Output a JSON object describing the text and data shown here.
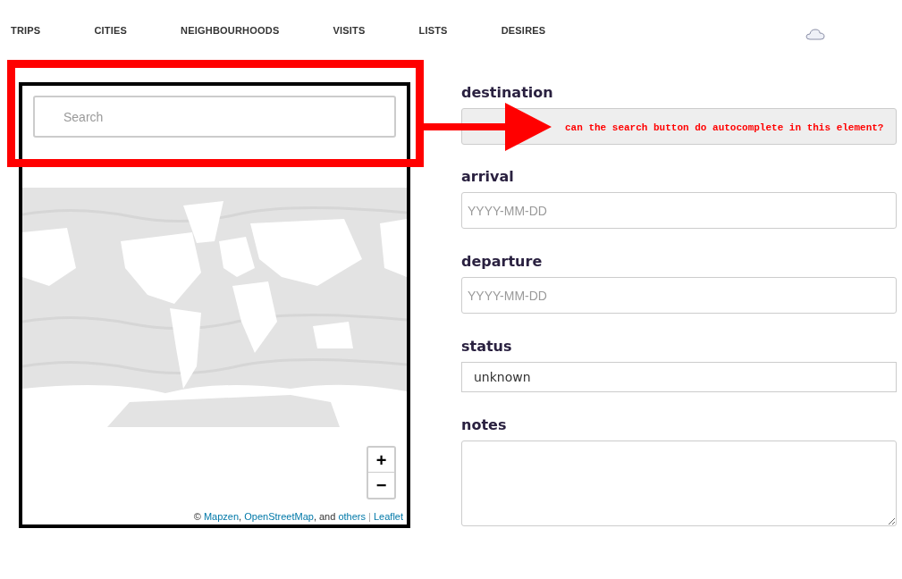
{
  "nav": {
    "items": [
      {
        "label": "TRIPS"
      },
      {
        "label": "CITIES"
      },
      {
        "label": "NEIGHBOURHOODS"
      },
      {
        "label": "VISITS"
      },
      {
        "label": "LISTS"
      },
      {
        "label": "DESIRES"
      }
    ]
  },
  "map_panel": {
    "search": {
      "placeholder": "Search"
    },
    "zoom_controls": [
      "+",
      "−"
    ],
    "attribution": [
      {
        "kind": "text",
        "text": "© "
      },
      {
        "kind": "link",
        "text": "Mapzen"
      },
      {
        "kind": "text",
        "text": ", "
      },
      {
        "kind": "link",
        "text": "OpenStreetMap"
      },
      {
        "kind": "text",
        "text": ", and "
      },
      {
        "kind": "link",
        "text": "others"
      },
      {
        "kind": "separator",
        "text": " | "
      },
      {
        "kind": "link",
        "text": "Leaflet"
      }
    ]
  },
  "form": {
    "fields": [
      {
        "label": "destination",
        "kind": "input",
        "disabled": true
      },
      {
        "label": "arrival",
        "kind": "input",
        "disabled": false,
        "placeholder": "YYYY-MM-DD"
      },
      {
        "label": "departure",
        "kind": "input",
        "disabled": false,
        "placeholder": "YYYY-MM-DD"
      },
      {
        "label": "status",
        "kind": "select",
        "value": "unknown"
      },
      {
        "label": "notes",
        "kind": "textarea"
      }
    ]
  },
  "annotation": {
    "note": "can the search button do autocomplete in this element?"
  }
}
